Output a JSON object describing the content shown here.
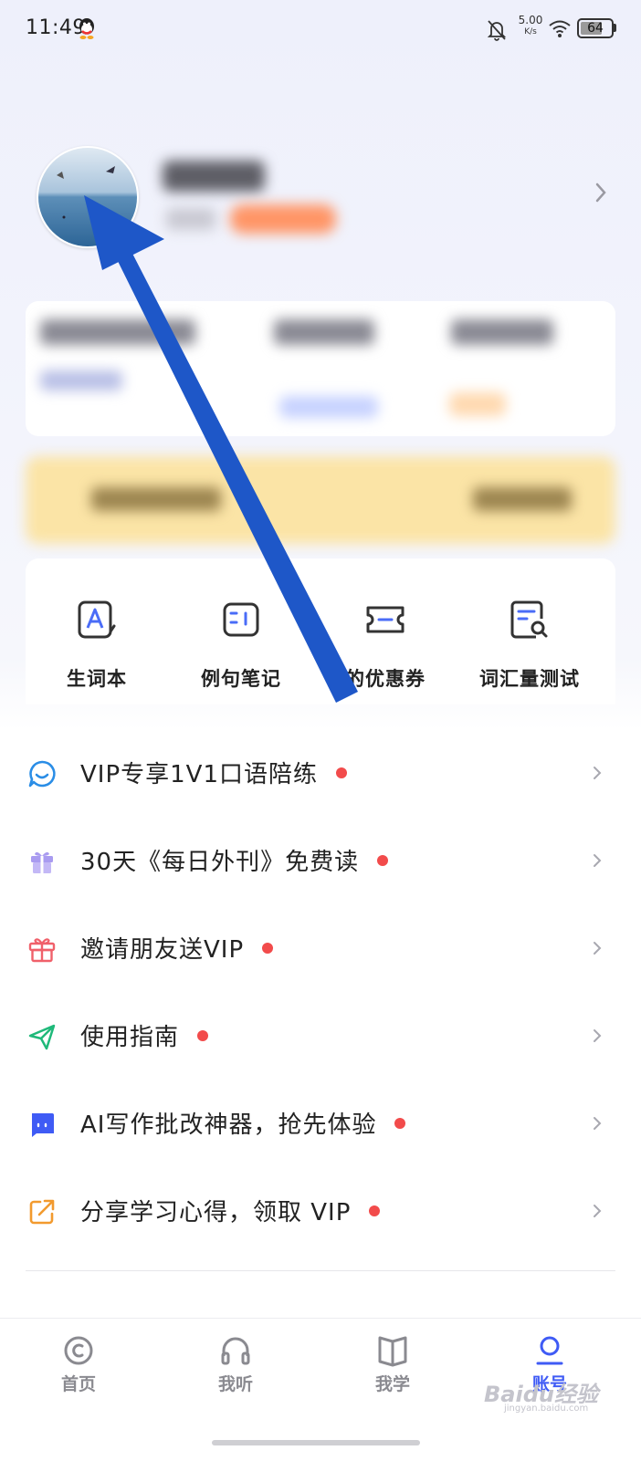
{
  "status_bar": {
    "time": "11:49",
    "network_speed_value": "5.00",
    "network_speed_unit": "K/s",
    "battery_percent": "64",
    "icons": [
      "qq-icon",
      "bell-off-icon",
      "wifi-icon",
      "battery-icon"
    ]
  },
  "profile": {
    "avatar_icon": "avatar-image",
    "name_blurred": true,
    "chevron_icon": "chevron-right-icon"
  },
  "quick_tools": [
    {
      "label": "生词本",
      "icon": "vocabulary-book-icon"
    },
    {
      "label": "例句笔记",
      "icon": "sentence-notes-icon"
    },
    {
      "label": "的优惠券",
      "icon": "coupon-icon"
    },
    {
      "label": "词汇量测试",
      "icon": "vocab-test-icon"
    }
  ],
  "menu": [
    {
      "label": "VIP专享1V1口语陪练",
      "icon": "chat-bubble-icon",
      "color": "#2a8de6",
      "badge": true
    },
    {
      "label": "30天《每日外刊》免费读",
      "icon": "gift-box-icon",
      "color": "#a99bf0",
      "badge": true
    },
    {
      "label": "邀请朋友送VIP",
      "icon": "gift-icon",
      "color": "#f0606a",
      "badge": true
    },
    {
      "label": "使用指南",
      "icon": "paper-plane-icon",
      "color": "#1fb97a",
      "badge": true
    },
    {
      "label": "AI写作批改神器，抢先体验",
      "icon": "ai-bot-icon",
      "color": "#3f5bf5",
      "badge": true
    },
    {
      "label": "分享学习心得，领取 VIP",
      "icon": "share-icon",
      "color": "#f29a2e",
      "badge": true
    }
  ],
  "bottom_nav": {
    "tabs": [
      {
        "label": "首页",
        "icon": "home-disc-icon",
        "active": false
      },
      {
        "label": "我听",
        "icon": "headphones-icon",
        "active": false
      },
      {
        "label": "我学",
        "icon": "open-book-icon",
        "active": false
      },
      {
        "label": "账号",
        "icon": "user-icon",
        "active": true
      }
    ]
  },
  "watermark": {
    "text": "Baidu经验",
    "sub": "jingyan.baidu.com"
  },
  "colors": {
    "accent": "#3f5bf5",
    "annotation_arrow": "#1e57c8",
    "red_dot": "#f24b4b",
    "vip_banner": "#fbe4a6"
  }
}
